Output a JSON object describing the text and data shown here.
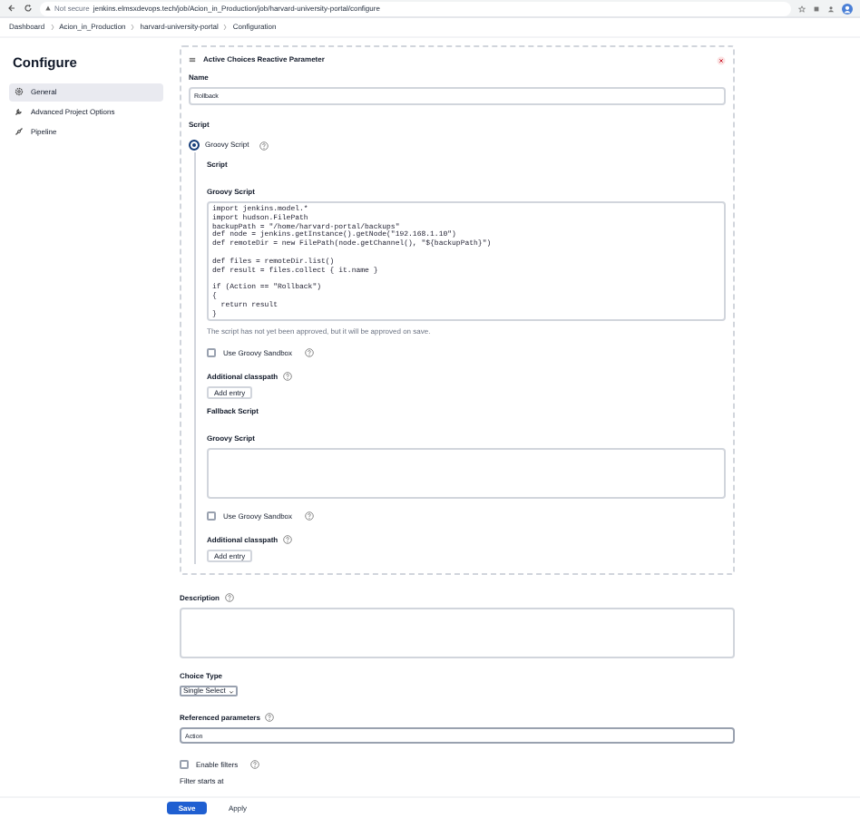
{
  "browser": {
    "security": "Not secure",
    "url": "jenkins.elmsxdevops.tech/job/Acion_in_Production/job/harvard-university-portal/configure"
  },
  "breadcrumbs": [
    "Dashboard",
    "Acion_in_Production",
    "harvard-university-portal",
    "Configuration"
  ],
  "sidebar": {
    "title": "Configure",
    "items": [
      {
        "label": "General",
        "selected": true
      },
      {
        "label": "Advanced Project Options",
        "selected": false
      },
      {
        "label": "Pipeline",
        "selected": false
      }
    ]
  },
  "parameter": {
    "title": "Active Choices Reactive Parameter",
    "name_label": "Name",
    "name_value": "Rollback",
    "script_label": "Script",
    "script_option": {
      "label": "Groovy Script",
      "selected": true
    },
    "script": {
      "heading": "Script",
      "label": "Groovy Script",
      "code": "import jenkins.model.*\nimport hudson.FilePath\nbackupPath = \"/home/harvard-portal/backups\"\ndef node = jenkins.getInstance().getNode(\"192.168.1.10\")\ndef remoteDir = new FilePath(node.getChannel(), \"${backupPath}\")\n\ndef files = remoteDir.list()\ndef result = files.collect { it.name }\n\nif (Action == \"Rollback\")\n{\n  return result\n}",
      "hint": "The script has not yet been approved, but it will be approved on save.",
      "sandbox_label": "Use Groovy Sandbox",
      "sandbox": false,
      "classpath_label": "Additional classpath",
      "add_button": "Add entry"
    },
    "fallback": {
      "heading": "Fallback Script",
      "label": "Groovy Script",
      "sandbox_label": "Use Groovy Sandbox",
      "sandbox": false,
      "classpath_label": "Additional classpath",
      "add_button": "Add entry"
    }
  },
  "description_label": "Description",
  "choice_type": {
    "label": "Choice Type",
    "value": "Single Select"
  },
  "referenced": {
    "label": "Referenced parameters",
    "value": "Action"
  },
  "filters": {
    "label": "Enable filters",
    "checked": false
  },
  "filter_start_label": "Filter starts at",
  "buttons": [
    {
      "label": "Save",
      "kind": "primary"
    },
    {
      "label": "Apply",
      "kind": "secondary"
    }
  ]
}
